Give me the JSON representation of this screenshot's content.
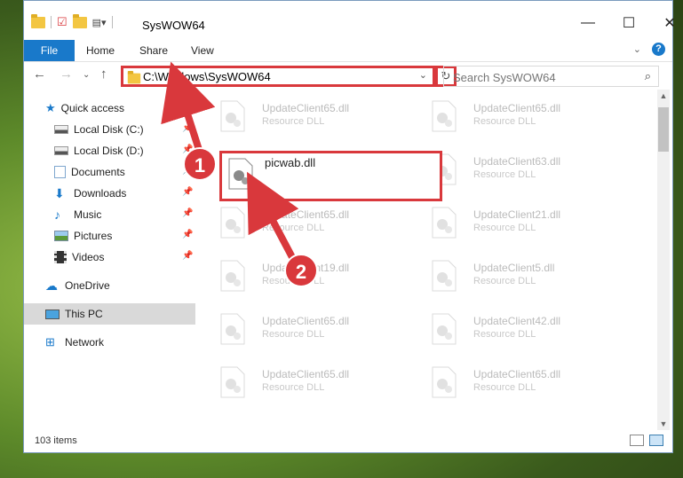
{
  "window": {
    "title": "SysWOW64",
    "controls": [
      "minimize",
      "maximize",
      "close"
    ]
  },
  "ribbon": {
    "file_tab": "File",
    "tabs": [
      "Home",
      "Share",
      "View"
    ]
  },
  "address_bar": {
    "path": "C:\\Windows\\SysWOW64",
    "search_placeholder": "Search SysWOW64"
  },
  "sidebar": {
    "items": [
      {
        "label": "Quick access",
        "icon": "star-icon",
        "pinned": false
      },
      {
        "label": "Local Disk (C:)",
        "icon": "drive-icon",
        "pinned": true
      },
      {
        "label": "Local Disk (D:)",
        "icon": "drive-icon",
        "pinned": true
      },
      {
        "label": "Documents",
        "icon": "documents-icon",
        "pinned": true
      },
      {
        "label": "Downloads",
        "icon": "download-icon",
        "pinned": true
      },
      {
        "label": "Music",
        "icon": "music-icon",
        "pinned": true
      },
      {
        "label": "Pictures",
        "icon": "pictures-icon",
        "pinned": true
      },
      {
        "label": "Videos",
        "icon": "videos-icon",
        "pinned": true
      },
      {
        "label": "OneDrive",
        "icon": "cloud-icon",
        "pinned": false
      },
      {
        "label": "This PC",
        "icon": "computer-icon",
        "pinned": false,
        "selected": true
      },
      {
        "label": "Network",
        "icon": "network-icon",
        "pinned": false
      }
    ]
  },
  "files": [
    {
      "name": "UpdateClient65.dll",
      "type": "Resource DLL"
    },
    {
      "name": "UpdateClient65.dll",
      "type": "Resource DLL"
    },
    {
      "name": "UpdateClient63.dll",
      "type": "Resource DLL"
    },
    {
      "name": "UpdateClient65.dll",
      "type": "Resource DLL"
    },
    {
      "name": "UpdateClient21.dll",
      "type": "Resource DLL"
    },
    {
      "name": "UpdateClient19.dll",
      "type": "Resource DLL"
    },
    {
      "name": "UpdateClient5.dll",
      "type": "Resource DLL"
    },
    {
      "name": "UpdateClient65.dll",
      "type": "Resource DLL"
    },
    {
      "name": "UpdateClient42.dll",
      "type": "Resource DLL"
    },
    {
      "name": "UpdateClient65.dll",
      "type": "Resource DLL"
    },
    {
      "name": "UpdateClient65.dll",
      "type": "Resource DLL"
    }
  ],
  "highlighted_file": {
    "name": "picwab.dll"
  },
  "status": {
    "item_count": "103 items"
  },
  "callouts": [
    "1",
    "2"
  ],
  "colors": {
    "accent": "#1979ca",
    "highlight": "#d9383c",
    "selected_bg": "#d9d9d9"
  }
}
